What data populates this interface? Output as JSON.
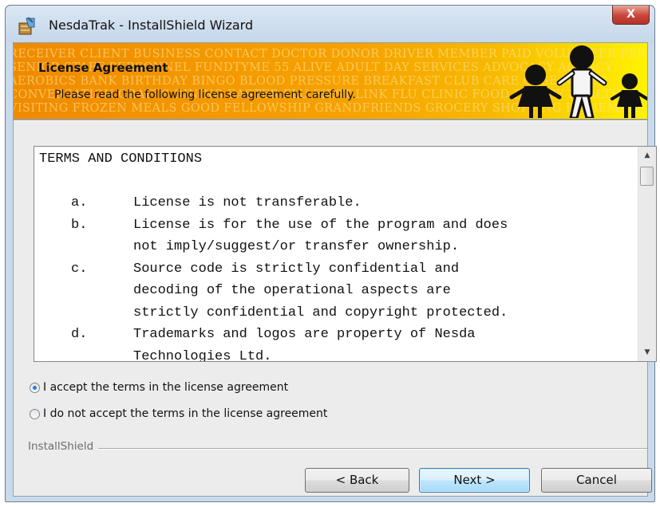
{
  "window": {
    "title": "NesdaTrak - InstallShield Wizard",
    "close_symbol": "X"
  },
  "banner": {
    "title": "License Agreement",
    "subtitle": "Please read the following license agreement carefully.",
    "background_words": [
      "RECEIVER  CLIENT  BUSINESS  CONTACT  DOCTOR  DONOR  DRIVER  MEMBER  PAID  VOLUNTEER  PERSON  WORKER",
      "SENIOR  STAFF  PERSONNEL  FUNDTYME  55  ALIVE  ADULT  DAY  SERVICES  ADVOCACY  AGENCY",
      "AEROBICS  BANK  BIRTHDAY  BINGO  BLOOD  PRESSURE  BREAKFAST  CLUB  CARE  CASE  NOTES",
      "CONVERSATION  CRAFTS  DINING  EASTER  FLU  FIRST  LINK  FLU  CLINIC  FOOD  PANTRY  HEALTH",
      "VISITING  FROZEN  MEALS  GOOD  FELLOWSHIP  GRANDFRIENDS  GROCERY  SHOPPING  HOMEMAKER"
    ],
    "colors": {
      "orange": "#f08a00",
      "yellow": "#fff200"
    }
  },
  "license": {
    "heading": "TERMS AND CONDITIONS",
    "clauses": [
      {
        "letter": "a.",
        "lines": [
          "License is not transferable."
        ]
      },
      {
        "letter": "b.",
        "lines": [
          "License is for the use of the program and does",
          "not imply/suggest/or transfer ownership."
        ]
      },
      {
        "letter": "c.",
        "lines": [
          "Source code is strictly confidential and",
          "decoding of the operational aspects are",
          "strictly confidential and copyright protected."
        ]
      },
      {
        "letter": "d.",
        "lines": [
          "Trademarks and logos are property of Nesda",
          "Technologies Ltd."
        ]
      }
    ]
  },
  "options": {
    "accept_label": "I accept the terms in the license agreement",
    "decline_label": "I do not accept the terms in the license agreement",
    "selected": "accept"
  },
  "footer": {
    "group_label": "InstallShield",
    "back_label": "< Back",
    "next_label": "Next >",
    "cancel_label": "Cancel"
  },
  "icons": {
    "title_icon": "installer-icon",
    "scroll_up": "chevron-up-icon",
    "scroll_down": "chevron-down-icon"
  }
}
